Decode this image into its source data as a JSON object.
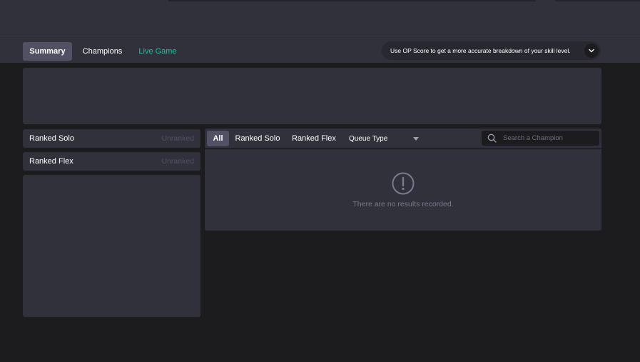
{
  "tabs": [
    {
      "label": "Summary"
    },
    {
      "label": "Champions"
    },
    {
      "label": "Live Game"
    }
  ],
  "banner": {
    "text": "Use OP Score to get a more accurate breakdown of your skill level.",
    "expand_icon": "chevron-down-icon"
  },
  "ranked": [
    {
      "queue": "Ranked Solo",
      "status": "Unranked"
    },
    {
      "queue": "Ranked Flex",
      "status": "Unranked"
    }
  ],
  "filters": {
    "tabs": [
      {
        "label": "All"
      },
      {
        "label": "Ranked Solo"
      },
      {
        "label": "Ranked Flex"
      }
    ],
    "queue_type": "Queue Type",
    "search_placeholder": "Search a Champion",
    "search_icon": "search-icon"
  },
  "results": {
    "empty_message": "There are no results recorded.",
    "empty_icon": "exclamation-circle-icon"
  },
  "colors": {
    "accent_live": "#16c5a0",
    "panel": "#31313c",
    "background": "#1c1c1f",
    "active_tab": "#515163"
  }
}
